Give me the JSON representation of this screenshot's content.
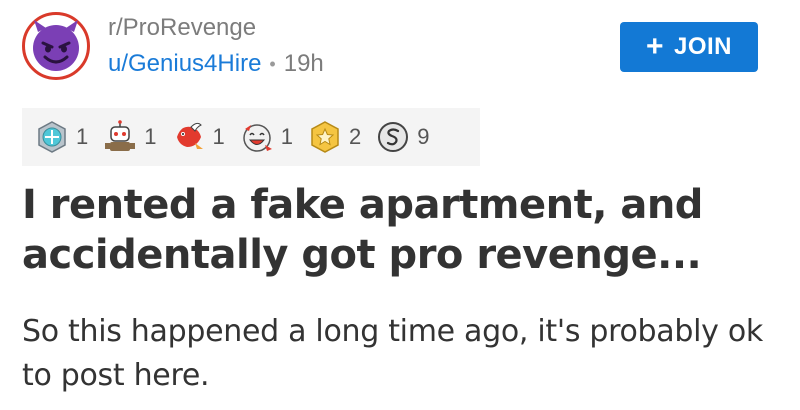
{
  "post": {
    "subreddit": "r/ProRevenge",
    "username": "u/Genius4Hire",
    "separator": "•",
    "age": "19h",
    "title": "I rented a fake apartment, and accidentally got pro revenge...",
    "body": "So this happened a long time ago, it's probably ok to post here."
  },
  "join_button": {
    "label": "JOIN",
    "icon": "plus-icon",
    "color": "#1379d5"
  },
  "avatar": {
    "icon": "devil-face-icon",
    "color": "#7b3fb5",
    "ring_color": "#d93a2a"
  },
  "awards": [
    {
      "icon": "platinum-award-icon",
      "count": "1"
    },
    {
      "icon": "robot-award-icon",
      "count": "1"
    },
    {
      "icon": "bird-award-icon",
      "count": "1"
    },
    {
      "icon": "laughing-award-icon",
      "count": "1"
    },
    {
      "icon": "gold-award-icon",
      "count": "2"
    },
    {
      "icon": "silver-award-icon",
      "count": "9"
    }
  ]
}
